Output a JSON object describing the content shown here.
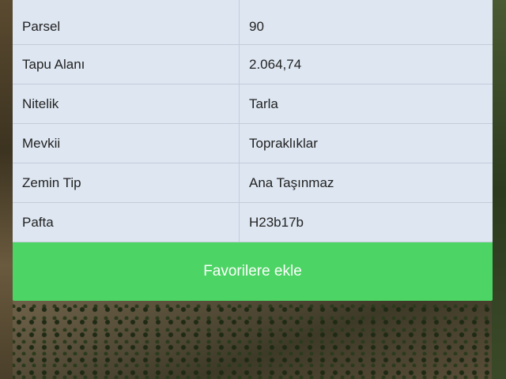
{
  "parcel_details": {
    "rows": [
      {
        "label": "Parsel",
        "value": "90"
      },
      {
        "label": "Tapu Alanı",
        "value": "2.064,74"
      },
      {
        "label": "Nitelik",
        "value": "Tarla"
      },
      {
        "label": "Mevkii",
        "value": "Topraklıklar"
      },
      {
        "label": "Zemin Tip",
        "value": "Ana Taşınmaz"
      },
      {
        "label": "Pafta",
        "value": "H23b17b"
      }
    ]
  },
  "actions": {
    "favorite_label": "Favorilere ekle"
  },
  "colors": {
    "button_green": "#4cd464",
    "table_background": "#dde6f1",
    "divider": "#c3ccd8"
  }
}
